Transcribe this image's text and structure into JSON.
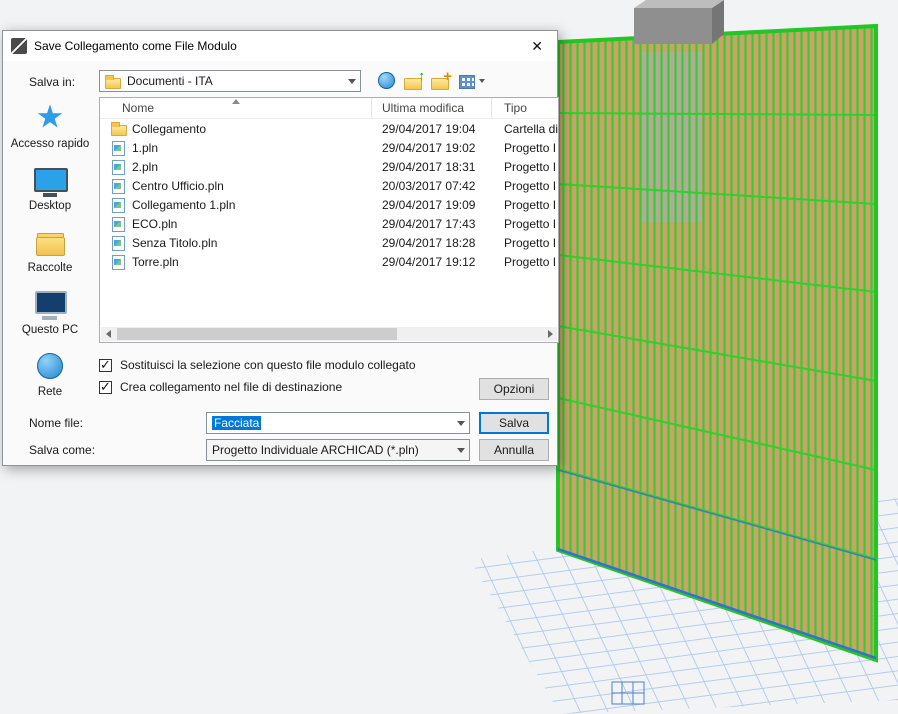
{
  "dialog": {
    "title": "Save Collegamento come File Modulo",
    "close_glyph": "✕",
    "save_in": {
      "label": "Salva in:",
      "value": "Documenti - ITA"
    },
    "toolbar_icons": [
      "go-to-last-folder",
      "up-one-level",
      "create-new-folder",
      "view-menu"
    ],
    "sidebar": [
      {
        "label": "Accesso rapido",
        "icon": "star"
      },
      {
        "label": "Desktop",
        "icon": "desktop"
      },
      {
        "label": "Raccolte",
        "icon": "libraries"
      },
      {
        "label": "Questo PC",
        "icon": "pc"
      },
      {
        "label": "Rete",
        "icon": "network"
      }
    ],
    "file_list": {
      "columns": [
        {
          "label": "Nome"
        },
        {
          "label": "Ultima modifica"
        },
        {
          "label": "Tipo"
        }
      ],
      "sort_column": "Nome",
      "rows": [
        {
          "icon": "folder",
          "name": "Collegamento",
          "modified": "29/04/2017 19:04",
          "type": "Cartella di"
        },
        {
          "icon": "pln",
          "name": "1.pln",
          "modified": "29/04/2017 19:02",
          "type": "Progetto I"
        },
        {
          "icon": "pln",
          "name": "2.pln",
          "modified": "29/04/2017 18:31",
          "type": "Progetto I"
        },
        {
          "icon": "pln",
          "name": "Centro Ufficio.pln",
          "modified": "20/03/2017 07:42",
          "type": "Progetto I"
        },
        {
          "icon": "pln",
          "name": "Collegamento 1.pln",
          "modified": "29/04/2017 19:09",
          "type": "Progetto I"
        },
        {
          "icon": "pln",
          "name": "ECO.pln",
          "modified": "29/04/2017 17:43",
          "type": "Progetto I"
        },
        {
          "icon": "pln",
          "name": "Senza Titolo.pln",
          "modified": "29/04/2017 18:28",
          "type": "Progetto I"
        },
        {
          "icon": "pln",
          "name": "Torre.pln",
          "modified": "29/04/2017 19:12",
          "type": "Progetto I"
        }
      ]
    },
    "options": [
      {
        "label": "Sostituisci la selezione con questo file modulo collegato",
        "checked": true
      },
      {
        "label": "Crea collegamento nel file di destinazione",
        "checked": true
      }
    ],
    "file_name": {
      "label": "Nome file:",
      "value": "Facciata"
    },
    "save_as_type": {
      "label": "Salva come:",
      "value": "Progetto Individuale ARCHICAD (*.pln)"
    },
    "buttons": {
      "options": "Opzioni",
      "save": "Salva",
      "cancel": "Annulla"
    }
  },
  "colors": {
    "accent": "#0078d7",
    "model_green": "#2fcf2f",
    "model_tan": "#cda269",
    "grid_blue": "#b3cbe9"
  }
}
